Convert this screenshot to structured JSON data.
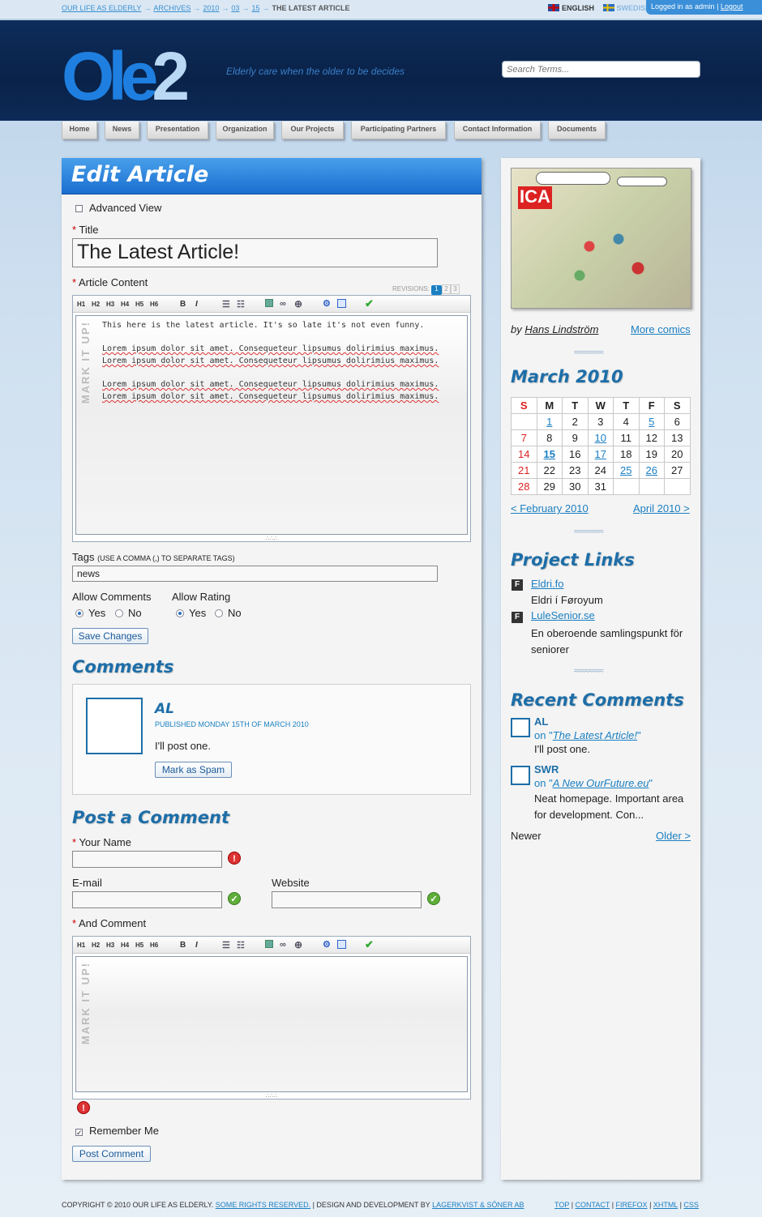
{
  "breadcrumb": {
    "items": [
      "Our life as elderly",
      "Archives",
      "2010",
      "03",
      "15"
    ],
    "current": "The Latest Article"
  },
  "lang": {
    "english": "ENGLISH",
    "swedish": "SWEDISH"
  },
  "login": {
    "text": "Logged in as admin",
    "logout": "Logout"
  },
  "site": {
    "logo_a": "Ole",
    "logo_b": "2",
    "tagline": "Elderly care when the older to be decides"
  },
  "search": {
    "placeholder": "Search Terms..."
  },
  "nav": [
    "Home",
    "News",
    "Presentation",
    "Organization",
    "Our Projects",
    "Participating Partners",
    "Contact Information",
    "Documents"
  ],
  "edit": {
    "heading": "Edit Article",
    "advanced": "Advanced View",
    "title_label": "Title",
    "title_value": "The Latest Article!",
    "content_label": "Article Content",
    "revisions_label": "REVISIONS:",
    "revisions": [
      "1",
      "2",
      "3"
    ],
    "toolbar": [
      "H1",
      "H2",
      "H3",
      "H4",
      "H5",
      "H6",
      "B",
      "I"
    ],
    "mark": "MARK IT UP!",
    "content_line1": "This here is the latest article. It's so late it's not even funny.",
    "lorem": "Lorem ipsum dolor sit amet. Consequeteur lipsumus dolirimius maximus. Lorem ipsum dolor sit amet. Consequeteur lipsumus dolirimius maximus.",
    "tags_label": "Tags",
    "tags_hint": "(use a comma (,) to separate tags)",
    "tags_value": "news",
    "allow_comments": "Allow Comments",
    "allow_rating": "Allow Rating",
    "yes": "Yes",
    "no": "No",
    "save": "Save Changes"
  },
  "comments": {
    "heading": "Comments",
    "author": "AL",
    "published": "Published Monday 15th of March 2010",
    "text": "I'll post one.",
    "spam": "Mark as Spam"
  },
  "post": {
    "heading": "Post a Comment",
    "name": "Your Name",
    "email": "E-mail",
    "website": "Website",
    "comment": "And Comment",
    "remember": "Remember Me",
    "submit": "Post Comment"
  },
  "side": {
    "by": "by",
    "artist": "Hans Lindström",
    "more": "More comics",
    "month": "March 2010",
    "days": [
      "S",
      "M",
      "T",
      "W",
      "T",
      "F",
      "S"
    ],
    "prev": "< February 2010",
    "next": "April 2010 >",
    "links_heading": "Project Links",
    "link1": "Eldri.fo",
    "link1_desc": "Eldri í Føroyum",
    "link2": "LuleSenior.se",
    "link2_desc": "En oberoende samlingspunkt för seniorer",
    "recent_heading": "Recent Comments",
    "rc1_author": "AL",
    "rc1_on": "on \"",
    "rc1_post": "The Latest Article!",
    "rc1_close": "\"",
    "rc1_text": "I'll post one.",
    "rc2_author": "SWR",
    "rc2_on": "on \"",
    "rc2_post": "A New OurFuture.eu",
    "rc2_close": "\"",
    "rc2_text": "Neat homepage. Important area for development. Con...",
    "newer": "Newer",
    "older": "Older >"
  },
  "calendar": [
    [
      "",
      "1",
      "2",
      "3",
      "4",
      "5",
      "6"
    ],
    [
      "7",
      "8",
      "9",
      "10",
      "11",
      "12",
      "13"
    ],
    [
      "14",
      "15",
      "16",
      "17",
      "18",
      "19",
      "20"
    ],
    [
      "21",
      "22",
      "23",
      "24",
      "25",
      "26",
      "27"
    ],
    [
      "28",
      "29",
      "30",
      "31",
      "",
      "",
      ""
    ]
  ],
  "footer": {
    "copy": "Copyright © 2010 Our Life as Elderly.",
    "rights": "Some rights reserved.",
    "design": "| Design and development by",
    "dev": "Lagerkvist & Söner AB",
    "links": [
      "Top",
      "Contact",
      "Firefox",
      "XHTML",
      "CSS"
    ]
  }
}
